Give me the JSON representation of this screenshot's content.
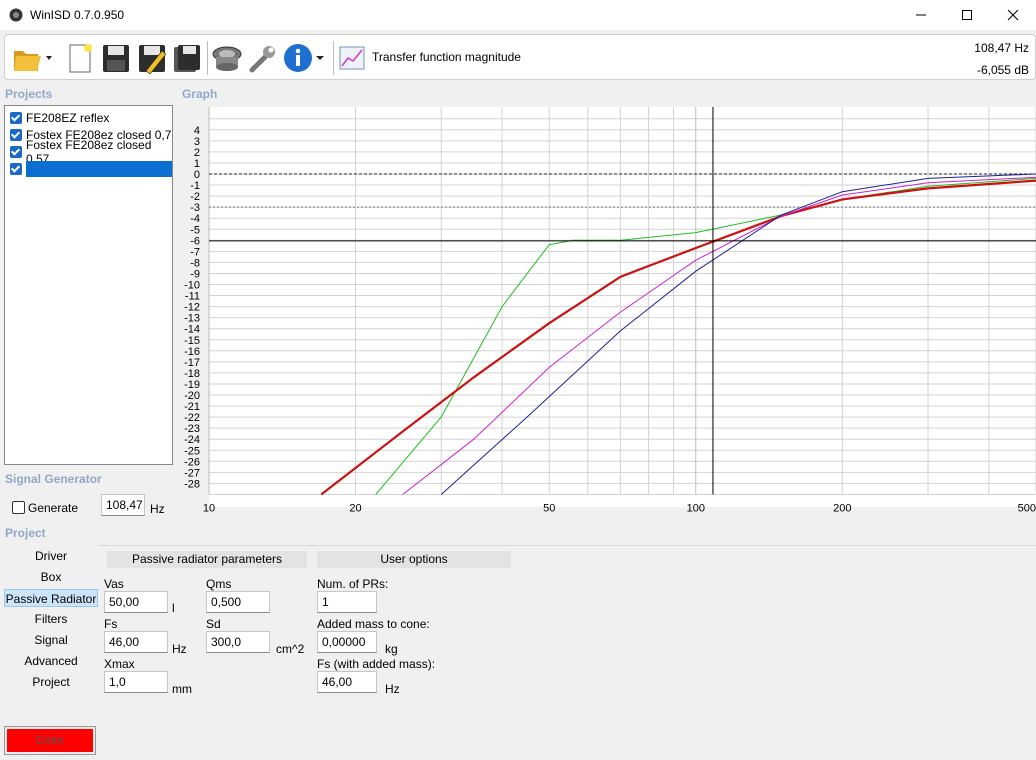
{
  "window": {
    "title": "WinISD 0.7.0.950"
  },
  "toolbar": {
    "view_label": "Transfer function magnitude"
  },
  "readout": {
    "freq": "108,47 Hz",
    "level": "-6,055 dB"
  },
  "projects": {
    "label": "Projects",
    "items": [
      {
        "label": "FE208EZ reflex",
        "checked": true
      },
      {
        "label": "Fostex FE208ez closed 0,7",
        "checked": true
      },
      {
        "label": "Fostex FE208ez closed 0,57",
        "checked": true
      },
      {
        "label": "",
        "checked": true,
        "selected": true
      }
    ]
  },
  "graph": {
    "label": "Graph"
  },
  "signal_generator": {
    "label": "Signal Generator",
    "generate_label": "Generate",
    "generate_checked": false,
    "freq_value": "108,47",
    "freq_unit": "Hz"
  },
  "project_section": {
    "label": "Project",
    "nav": [
      "Driver",
      "Box",
      "Passive Radiator",
      "Filters",
      "Signal",
      "Advanced",
      "Project"
    ],
    "active_index": 2,
    "color_button": "Color",
    "color_value": "#ff0000"
  },
  "pr_params": {
    "header": "Passive radiator parameters",
    "vas": {
      "label": "Vas",
      "value": "50,00",
      "unit": "l"
    },
    "qms": {
      "label": "Qms",
      "value": "0,500"
    },
    "fs": {
      "label": "Fs",
      "value": "46,00",
      "unit": "Hz"
    },
    "sd": {
      "label": "Sd",
      "value": "300,0",
      "unit": "cm^2"
    },
    "xmax": {
      "label": "Xmax",
      "value": "1,0",
      "unit": "mm"
    }
  },
  "user_options": {
    "header": "User options",
    "num_prs": {
      "label": "Num. of PRs:",
      "value": "1"
    },
    "added_mass": {
      "label": "Added mass to cone:",
      "value": "0,00000",
      "unit": "kg"
    },
    "fs_added": {
      "label": "Fs (with added mass):",
      "value": "46,00",
      "unit": "Hz"
    }
  },
  "chart_data": {
    "type": "line",
    "title": "",
    "xlabel": "",
    "ylabel": "",
    "x_scale": "log",
    "xlim": [
      10,
      500
    ],
    "ylim": [
      -29,
      5
    ],
    "x_ticks": [
      "10",
      "20",
      "50",
      "100",
      "200",
      "500"
    ],
    "y_ticks": [
      "4",
      "3",
      "2",
      "1",
      "0",
      "-1",
      "-2",
      "-3",
      "-4",
      "-5",
      "-6",
      "-7",
      "-8",
      "-9",
      "-10",
      "-11",
      "-12",
      "-13",
      "-14",
      "-15",
      "-16",
      "-17",
      "-18",
      "-19",
      "-20",
      "-21",
      "-22",
      "-23",
      "-24",
      "-25",
      "-26",
      "-27",
      "-28"
    ],
    "cursor": {
      "x": 108.47,
      "y": -6.055
    },
    "reference_lines": [
      0,
      -3
    ],
    "series": [
      {
        "color": "#22bb22",
        "x": [
          22,
          30,
          40,
          50,
          56,
          70,
          100,
          150,
          200,
          300,
          500
        ],
        "y": [
          -29,
          -22,
          -12,
          -6.4,
          -6,
          -6,
          -5.3,
          -3.7,
          -2.3,
          -1.1,
          -0.4
        ]
      },
      {
        "color": "#cc1111",
        "x": [
          17,
          25,
          35,
          50,
          70,
          100,
          150,
          200,
          300,
          500
        ],
        "y": [
          -29,
          -23.3,
          -18.4,
          -13.5,
          -9.3,
          -6.7,
          -3.8,
          -2.3,
          -1.3,
          -0.6
        ]
      },
      {
        "color": "#cc22cc",
        "x": [
          25,
          35,
          50,
          70,
          100,
          150,
          200,
          300,
          500
        ],
        "y": [
          -29,
          -24,
          -17.5,
          -12.5,
          -7.8,
          -3.8,
          -1.9,
          -0.8,
          -0.3
        ]
      },
      {
        "color": "#1f1f8f",
        "x": [
          30,
          45,
          70,
          100,
          150,
          200,
          300,
          500
        ],
        "y": [
          -29,
          -22,
          -14.2,
          -8.8,
          -3.7,
          -1.6,
          -0.4,
          0
        ]
      }
    ]
  }
}
